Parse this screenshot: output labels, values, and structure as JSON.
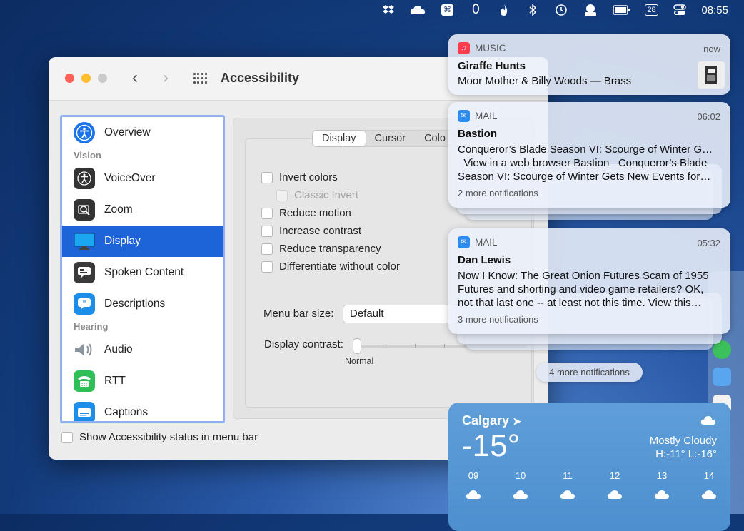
{
  "menubar": {
    "icons": [
      "dropbox-icon",
      "icloud-icon",
      "command-icon",
      "zero-icon",
      "flame-icon",
      "bluetooth-icon",
      "time-machine-icon",
      "app-icon",
      "battery-icon",
      "calendar-icon",
      "control-center-icon"
    ],
    "command_glyph": "⌘",
    "zero_glyph": "0",
    "calendar_day": "28",
    "time": "08:55"
  },
  "window": {
    "title": "Accessibility",
    "back_glyph": "‹",
    "forward_glyph": "›",
    "sidebar": {
      "items": [
        {
          "label": "Overview",
          "icon": "accessibility-icon",
          "color": "#1a73e8"
        },
        {
          "header": "Vision"
        },
        {
          "label": "VoiceOver",
          "icon": "voiceover-icon",
          "color": "#333333"
        },
        {
          "label": "Zoom",
          "icon": "zoom-icon",
          "color": "#333333"
        },
        {
          "label": "Display",
          "icon": "display-icon",
          "color": "#1a9ae8",
          "selected": true
        },
        {
          "label": "Spoken Content",
          "icon": "spoken-content-icon",
          "color": "#3a3a3a"
        },
        {
          "label": "Descriptions",
          "icon": "descriptions-icon",
          "color": "#1a8ee8"
        },
        {
          "header": "Hearing"
        },
        {
          "label": "Audio",
          "icon": "audio-icon",
          "color": "#9aa4ad"
        },
        {
          "label": "RTT",
          "icon": "rtt-icon",
          "color": "#2fbf57"
        },
        {
          "label": "Captions",
          "icon": "captions-icon",
          "color": "#1a8ee8"
        }
      ]
    },
    "tabs": [
      "Display",
      "Cursor",
      "Colo"
    ],
    "options": {
      "invert_colors": "Invert colors",
      "classic_invert": "Classic Invert",
      "reduce_motion": "Reduce motion",
      "increase_contrast": "Increase contrast",
      "reduce_transparency": "Reduce transparency",
      "differentiate": "Differentiate without color"
    },
    "menu_bar_size_label": "Menu bar size:",
    "menu_bar_size_value": "Default",
    "display_contrast_label": "Display contrast:",
    "display_contrast_caption": "Normal",
    "display_contrast_level": 0,
    "status_label": "Show Accessibility status in menu bar"
  },
  "notifications": [
    {
      "app": "MUSIC",
      "time": "now",
      "title": "Giraffe Hunts",
      "body": [
        "Moor Mother & Billy Woods — Brass"
      ],
      "app_color": "#fa3c4c"
    },
    {
      "app": "MAIL",
      "time": "06:02",
      "title": "Bastion",
      "body": [
        "Conqueror’s Blade Season VI: Scourge of Winter G…",
        "  View in a web browser Bastion   Conqueror’s Blade",
        "Season VI: Scourge of Winter Gets New Events for…"
      ],
      "more": "2 more notifications",
      "app_color": "#2d8cf0"
    },
    {
      "app": "MAIL",
      "time": "05:32",
      "title": "Dan Lewis",
      "body": [
        "Now I Know: The Great Onion Futures Scam of 1955",
        "Futures and shorting and video game retailers? OK,",
        "not that last one -- at least not this time. View this…"
      ],
      "more": "3 more notifications",
      "app_color": "#2d8cf0"
    }
  ],
  "more_notifications": "4 more notifications",
  "weather": {
    "city": "Calgary",
    "temp": "-15°",
    "condition": "Mostly Cloudy",
    "high_low": "H:-11° L:-16°",
    "hours": [
      "09",
      "10",
      "11",
      "12",
      "13",
      "14"
    ]
  }
}
